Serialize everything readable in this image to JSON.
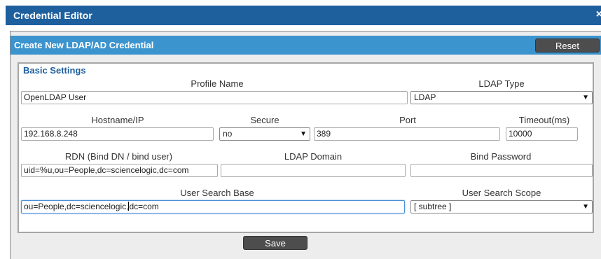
{
  "window": {
    "title": "Credential Editor",
    "close_glyph": "×"
  },
  "panel": {
    "title": "Create New LDAP/AD Credential",
    "reset_label": "Reset"
  },
  "fieldset": {
    "legend": "Basic Settings"
  },
  "fields": {
    "profile_name": {
      "label": "Profile Name",
      "value": "OpenLDAP User"
    },
    "ldap_type": {
      "label": "LDAP Type",
      "value": "LDAP"
    },
    "hostname": {
      "label": "Hostname/IP",
      "value": "192.168.8.248"
    },
    "secure": {
      "label": "Secure",
      "value": "no"
    },
    "port": {
      "label": "Port",
      "value": "389"
    },
    "timeout": {
      "label": "Timeout(ms)",
      "value": "10000"
    },
    "rdn": {
      "label": "RDN (Bind DN / bind user)",
      "value": "uid=%u,ou=People,dc=sciencelogic,dc=com"
    },
    "ldap_domain": {
      "label": "LDAP Domain",
      "value": ""
    },
    "bind_password": {
      "label": "Bind Password",
      "value": ""
    },
    "user_search_base": {
      "label": "User Search Base",
      "value_before_caret": "ou=People,dc=sciencelogic,",
      "value_after_caret": "dc=com"
    },
    "user_search_scope": {
      "label": "User Search Scope",
      "value": "[ subtree ]"
    }
  },
  "save_label": "Save",
  "icons": {
    "dropdown": "triangle-down-icon",
    "close": "close-icon"
  },
  "colors": {
    "titlebar": "#1e5f9e",
    "panel_header": "#3c94cf",
    "button": "#4d4d4d",
    "legend": "#1e5f9e"
  }
}
